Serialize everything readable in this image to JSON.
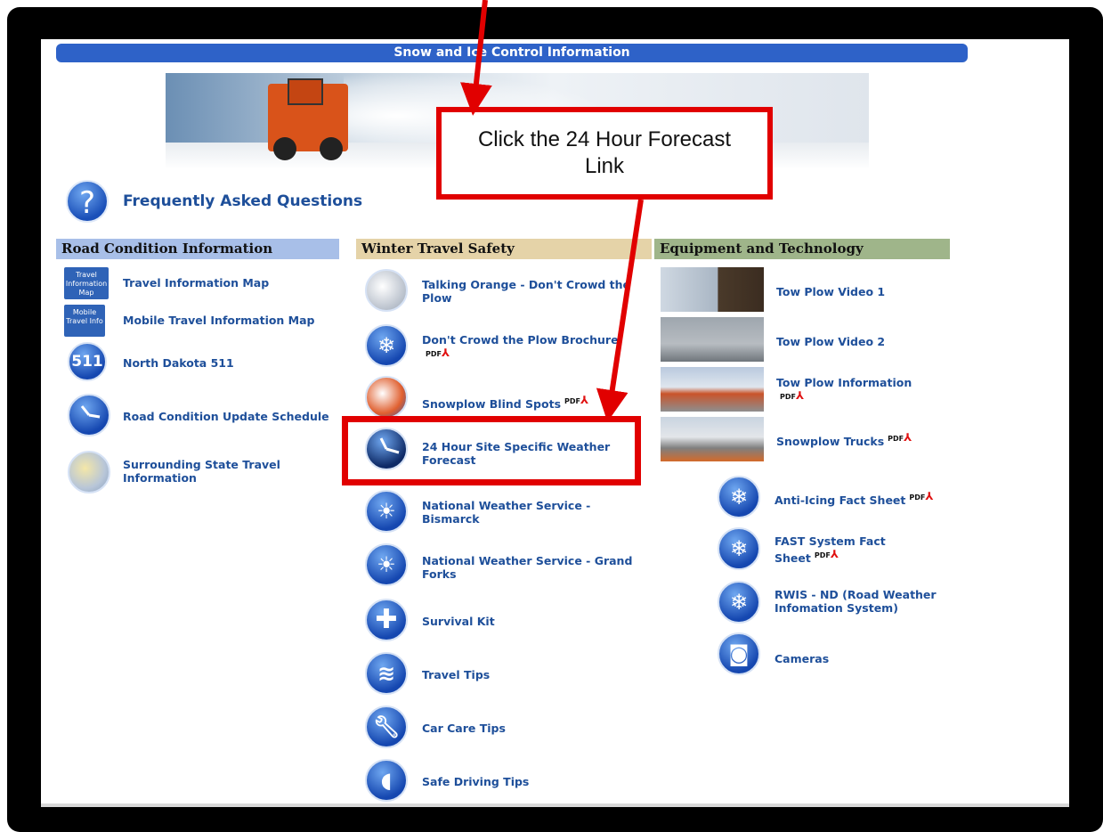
{
  "header": {
    "title": "Snow and Ice Control Information"
  },
  "faq": {
    "label": "Frequently Asked Questions",
    "icon": "question-icon"
  },
  "columns": {
    "road": {
      "heading": "Road Condition Information",
      "items": [
        {
          "label": "Travel Information Map",
          "icon_text": "Travel Information Map"
        },
        {
          "label": "Mobile Travel Information Map",
          "icon_text": "Mobile Travel Info"
        },
        {
          "label": "North Dakota 511",
          "icon_text": "511"
        },
        {
          "label": "Road Condition Update Schedule",
          "icon": "clock-icon"
        },
        {
          "label": "Surrounding State Travel Information",
          "icon": "map-icon"
        }
      ]
    },
    "winter": {
      "heading": "Winter Travel Safety",
      "items": [
        {
          "label": "Talking Orange - Don't Crowd the Plow",
          "icon": "slow-down-icon"
        },
        {
          "label": "Don't Crowd the Plow Brochure",
          "pdf": "PDF",
          "icon": "snowflake-icon"
        },
        {
          "label": "Snowplow Blind Spots",
          "pdf": "PDF",
          "icon": "plow-icon"
        },
        {
          "label": "24 Hour Site Specific Weather Forecast",
          "icon": "clock-icon"
        },
        {
          "label": "National Weather Service - Bismarck",
          "icon": "weather-icon"
        },
        {
          "label": "National Weather Service - Grand Forks",
          "icon": "weather-icon"
        },
        {
          "label": "Survival Kit",
          "icon": "plus-icon"
        },
        {
          "label": "Travel Tips",
          "icon": "road-icon"
        },
        {
          "label": "Car Care Tips",
          "icon": "wrench-icon"
        },
        {
          "label": "Safe Driving Tips",
          "icon": "headlight-icon"
        }
      ]
    },
    "equipment": {
      "heading": "Equipment and Technology",
      "items": [
        {
          "label": "Tow Plow Video 1"
        },
        {
          "label": "Tow Plow Video 2"
        },
        {
          "label": "Tow Plow Information",
          "pdf": "PDF"
        },
        {
          "label": "Snowplow Trucks",
          "pdf": "PDF"
        },
        {
          "label": "Anti-Icing Fact Sheet",
          "pdf": "PDF",
          "icon": "snowflake-icon"
        },
        {
          "label": "FAST System Fact Sheet",
          "pdf": "PDF",
          "icon": "snowflake-icon"
        },
        {
          "label": "RWIS - ND (Road Weather Infomation System)",
          "icon": "snowflake-icon"
        },
        {
          "label": "Cameras",
          "icon": "camera-icon"
        }
      ]
    }
  },
  "callout": {
    "text": "Click the 24 Hour Forecast Link"
  },
  "colors": {
    "accent_blue": "#2e62c8",
    "link_blue": "#1e4f9a",
    "annotation_red": "#e10000"
  }
}
